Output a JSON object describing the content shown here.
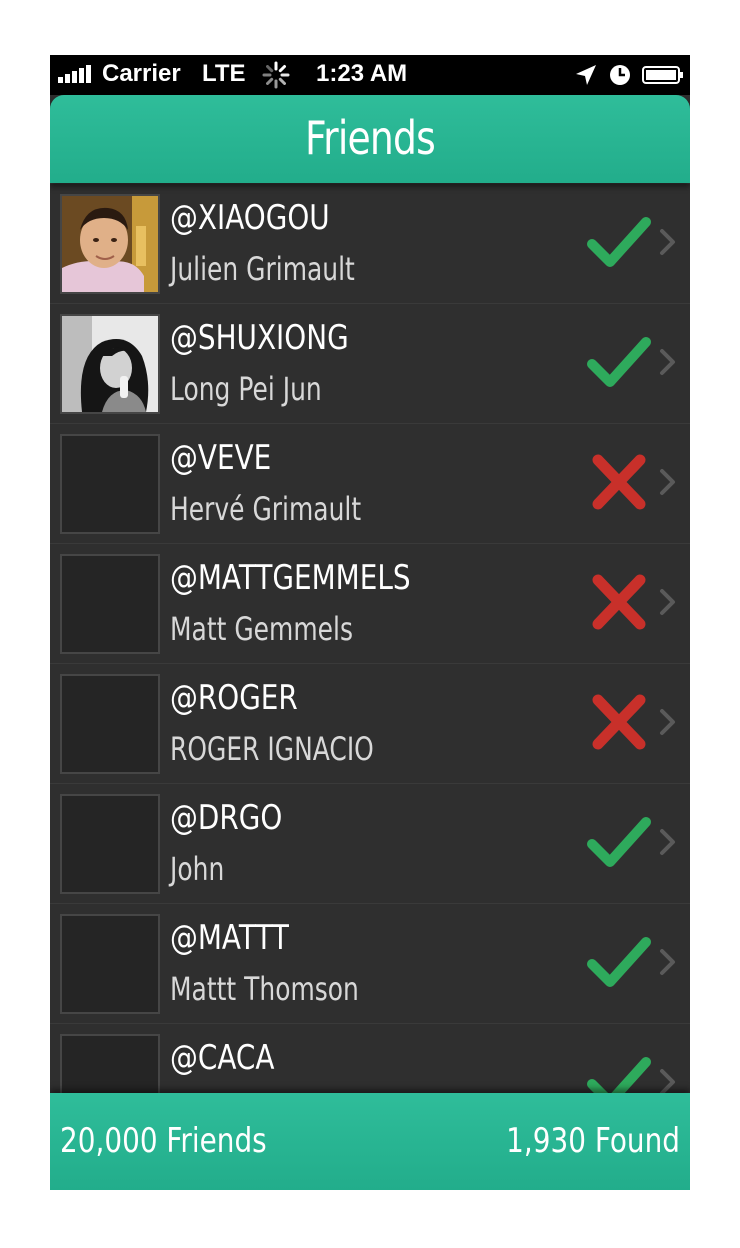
{
  "status_bar": {
    "carrier": "Carrier",
    "network": "LTE",
    "time": "1:23 AM"
  },
  "nav": {
    "title": "Friends"
  },
  "friends": [
    {
      "handle": "@XIAOGOU",
      "name": "Julien Grimault",
      "status": "confirmed",
      "avatar": "photo-man"
    },
    {
      "handle": "@SHUXIONG",
      "name": "Long Pei Jun",
      "status": "confirmed",
      "avatar": "photo-woman"
    },
    {
      "handle": "@VEVE",
      "name": "Hervé Grimault",
      "status": "rejected",
      "avatar": "empty"
    },
    {
      "handle": "@MATTGEMMELS",
      "name": "Matt Gemmels",
      "status": "rejected",
      "avatar": "empty"
    },
    {
      "handle": "@ROGER",
      "name": "ROGER IGNACIO",
      "status": "rejected",
      "avatar": "empty"
    },
    {
      "handle": "@DRGO",
      "name": "John",
      "status": "confirmed",
      "avatar": "empty"
    },
    {
      "handle": "@MATTT",
      "name": "Mattt Thomson",
      "status": "confirmed",
      "avatar": "empty"
    },
    {
      "handle": "@CACA",
      "name": "",
      "status": "confirmed",
      "avatar": "empty"
    }
  ],
  "footer": {
    "friends_count": "20,000 Friends",
    "found_count": "1,930 Found"
  },
  "colors": {
    "accent": "#27b592",
    "check": "#2eaa5c",
    "cross": "#c8302a",
    "row_bg": "#2f2f2f"
  },
  "icons": {
    "confirmed": "checkmark-icon",
    "rejected": "cross-icon",
    "disclosure": "chevron-right-icon"
  }
}
